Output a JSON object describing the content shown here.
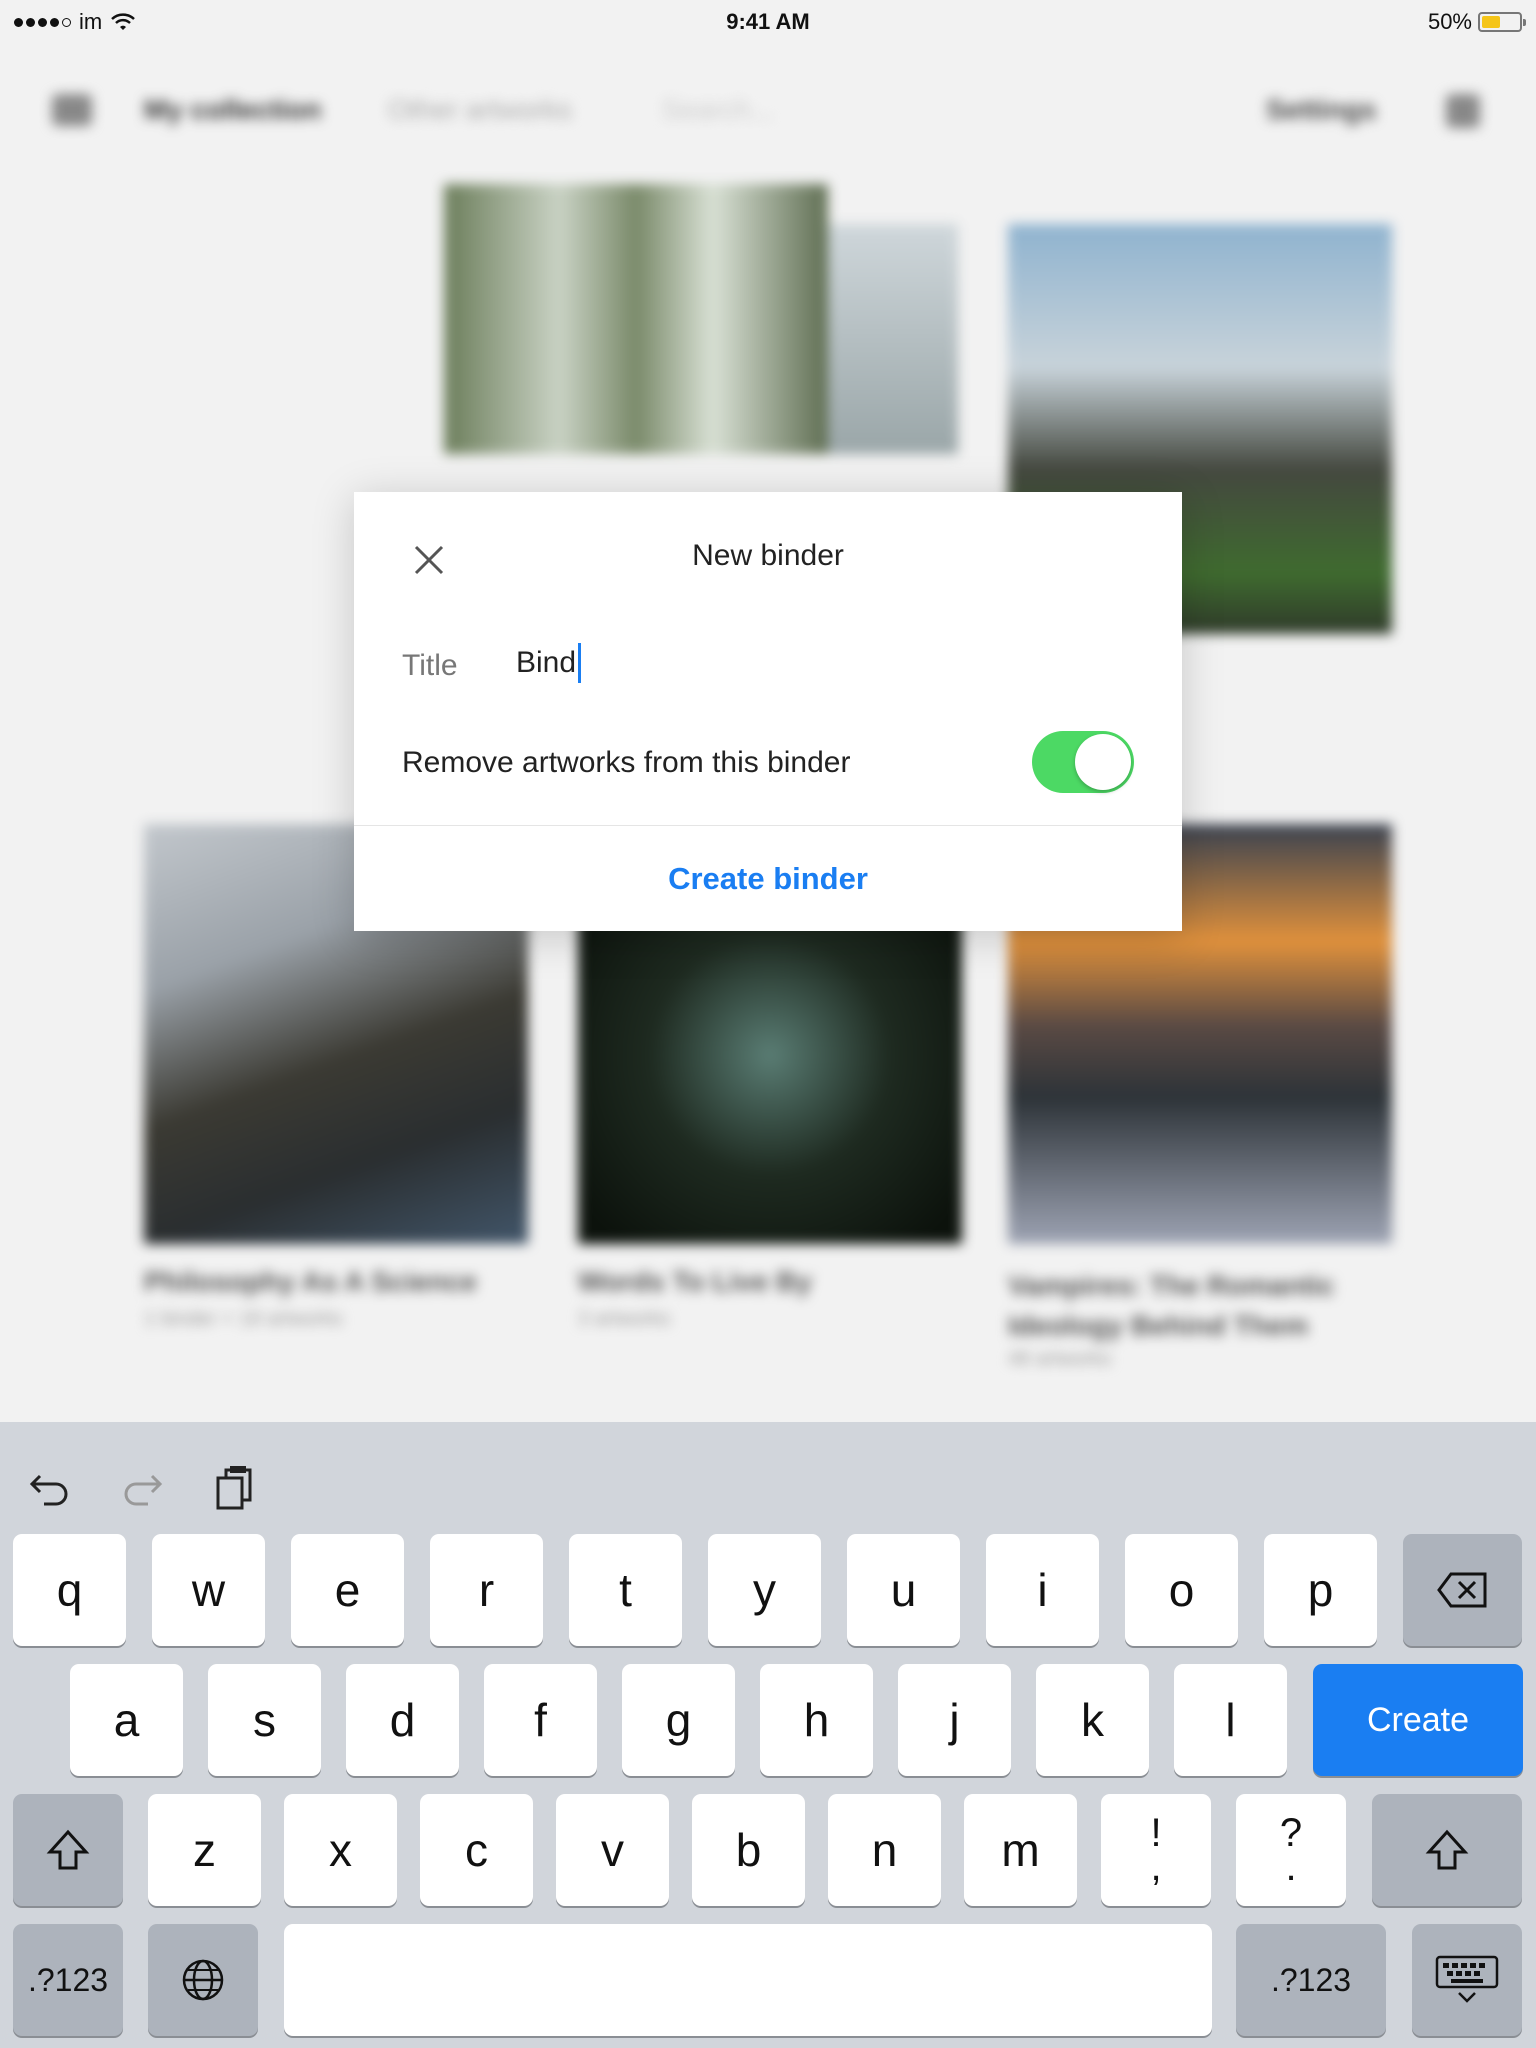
{
  "status_bar": {
    "carrier": "im",
    "time": "9:41 AM",
    "battery_percent": "50%",
    "battery_level": 0.5
  },
  "background": {
    "nav": {
      "my_collection": "My collection",
      "other_artworks": "Other artworks",
      "search_placeholder": "Search...",
      "settings": "Settings"
    },
    "cards": [
      {
        "title": "Philosophy As A Science",
        "subtitle": "1 binder + 18 artworks"
      },
      {
        "title": "Words To Live By",
        "subtitle": "3 artworks"
      },
      {
        "title": "Vampires: The Romantic Ideology Behind Them",
        "subtitle": "48 artworks"
      }
    ]
  },
  "dialog": {
    "title": "New binder",
    "title_label": "Title",
    "title_value": "Bind",
    "toggle_label": "Remove artworks from this binder",
    "toggle_on": true,
    "create_button": "Create binder"
  },
  "keyboard": {
    "row1": [
      "q",
      "w",
      "e",
      "r",
      "t",
      "y",
      "u",
      "i",
      "o",
      "p"
    ],
    "row2": [
      "a",
      "s",
      "d",
      "f",
      "g",
      "h",
      "j",
      "k",
      "l"
    ],
    "row3": [
      "z",
      "x",
      "c",
      "v",
      "b",
      "n",
      "m"
    ],
    "punct1": {
      "top": "!",
      "bottom": ","
    },
    "punct2": {
      "top": "?",
      "bottom": "."
    },
    "return_label": "Create",
    "numbers_label": ".?123"
  },
  "colors": {
    "accent": "#1a7ef2",
    "toggle_on": "#4cd964",
    "keyboard_bg": "#d1d5db"
  }
}
